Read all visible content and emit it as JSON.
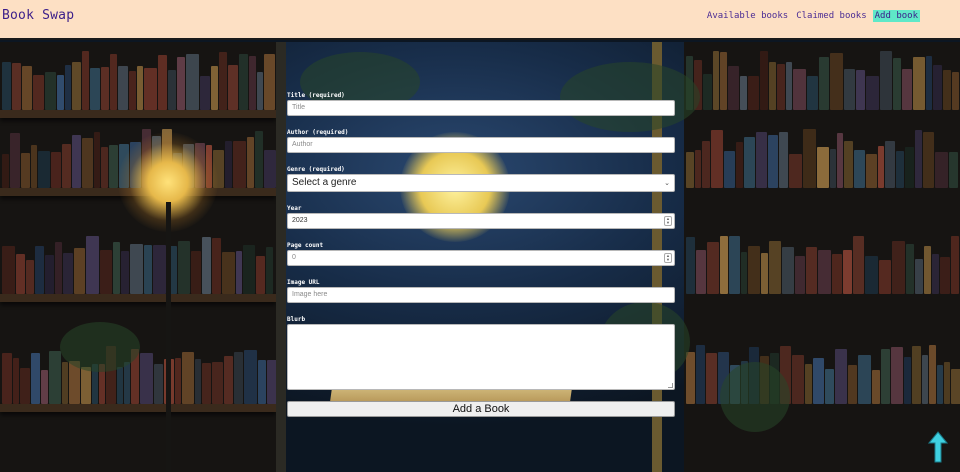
{
  "header": {
    "brand": "Book Swap",
    "nav": [
      {
        "label": "Available books"
      },
      {
        "label": "Claimed books"
      },
      {
        "label": "Add book",
        "active": true
      }
    ]
  },
  "form": {
    "title": {
      "label": "Title (required)",
      "placeholder": "Title"
    },
    "author": {
      "label": "Author (required)",
      "placeholder": "Author"
    },
    "genre": {
      "label": "Genre (required)",
      "value": "Select a genre"
    },
    "year": {
      "label": "Year",
      "value": "2023"
    },
    "page_count": {
      "label": "Page count",
      "placeholder": "0"
    },
    "image_url": {
      "label": "Image URL",
      "placeholder": "Image here"
    },
    "blurb": {
      "label": "Blurb",
      "value": ""
    },
    "submit_label": "Add a Book"
  },
  "colors": {
    "header_bg": "#fde0c4",
    "brand": "#3b1e8a",
    "nav_active_bg": "#5fe8c8",
    "scroll_top_arrow": "#3fd0e0"
  },
  "icons": {
    "scroll_top": "arrow-up-icon",
    "select": "chevron-down-icon"
  }
}
